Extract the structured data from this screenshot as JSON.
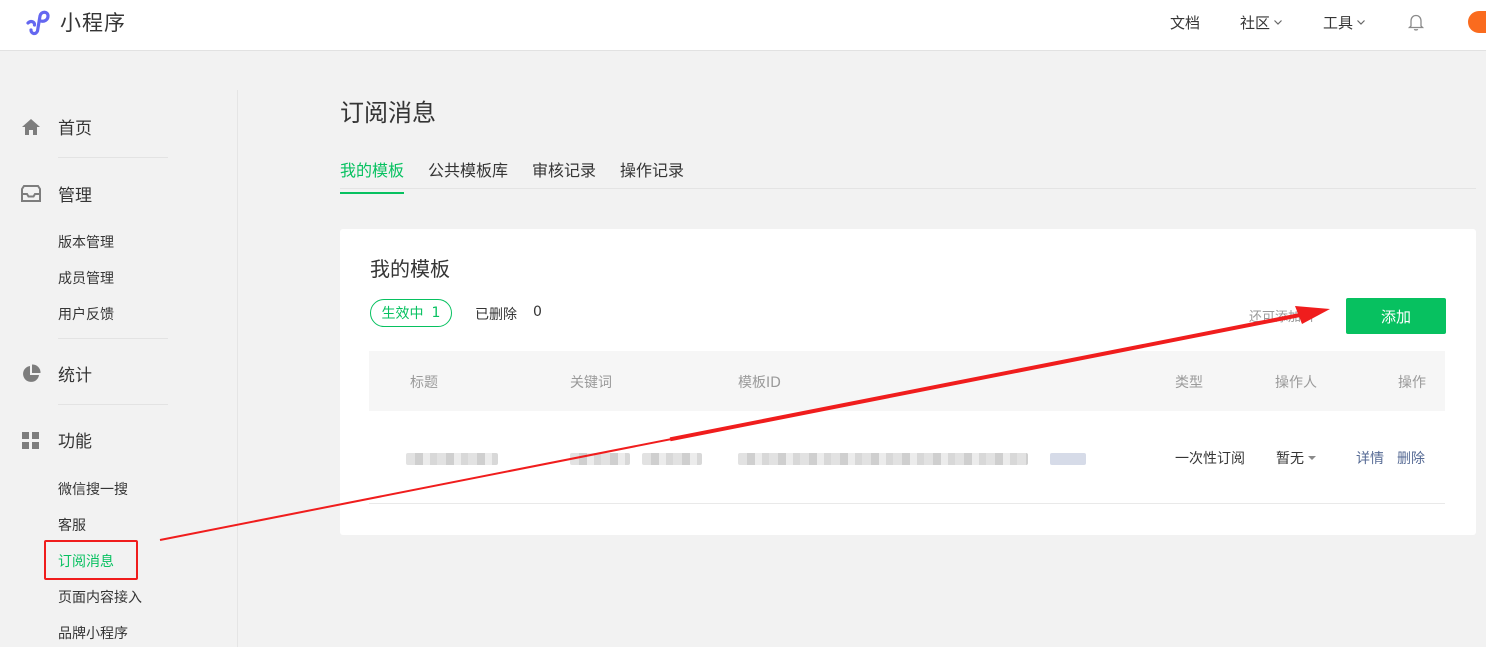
{
  "app": {
    "title": "小程序"
  },
  "topnav": {
    "docs": "文档",
    "community": "社区",
    "tools": "工具"
  },
  "sidebar": {
    "home": "首页",
    "manage": "管理",
    "manage_items": [
      "版本管理",
      "成员管理",
      "用户反馈"
    ],
    "stats": "统计",
    "features": "功能",
    "feature_items": [
      "微信搜一搜",
      "客服",
      "订阅消息",
      "页面内容接入",
      "品牌小程序"
    ]
  },
  "page": {
    "title": "订阅消息"
  },
  "tabs": [
    "我的模板",
    "公共模板库",
    "审核记录",
    "操作记录"
  ],
  "card": {
    "title": "我的模板",
    "active_label": "生效中",
    "active_count": "1",
    "deleted_label": "已删除",
    "deleted_count": "0",
    "remaining_text": "还可添加   个",
    "add_button": "添加"
  },
  "table": {
    "headers": [
      "标题",
      "关键词",
      "模板ID",
      "类型",
      "操作人",
      "操作"
    ],
    "rows": [
      {
        "type": "一次性订阅",
        "operator": "暂无",
        "action_detail": "详情",
        "action_delete": "删除"
      }
    ]
  },
  "colors": {
    "accent": "#07c160",
    "annotation": "#f01d1d",
    "link": "#576b95"
  }
}
